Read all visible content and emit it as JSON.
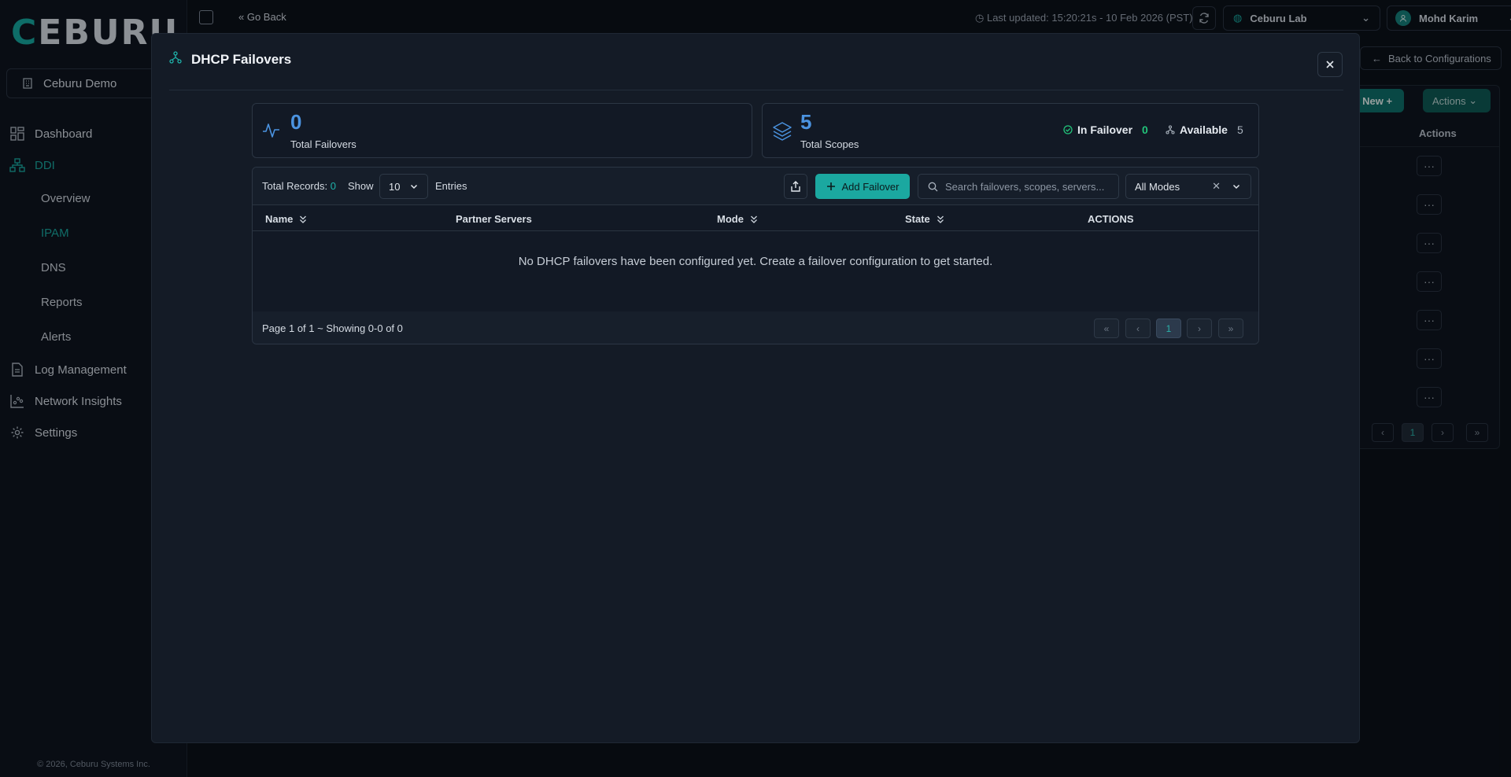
{
  "app": {
    "logo": "CEBURU",
    "org": "Ceburu Demo",
    "nav": [
      {
        "label": "Dashboard",
        "icon": "dashboard-icon"
      },
      {
        "label": "DDI",
        "icon": "network-icon",
        "active": true
      }
    ],
    "ddi_sub": [
      {
        "label": "Overview"
      },
      {
        "label": "IPAM",
        "active": true
      },
      {
        "label": "DNS"
      },
      {
        "label": "Reports"
      },
      {
        "label": "Alerts"
      }
    ],
    "nav_bottom": [
      {
        "label": "Log Management",
        "icon": "file-icon"
      },
      {
        "label": "Network Insights",
        "icon": "insights-icon"
      },
      {
        "label": "Settings",
        "icon": "gear-icon"
      }
    ],
    "copyright": "© 2026, Ceburu Systems Inc."
  },
  "topbar": {
    "go_back": "Go Back",
    "last_updated": "Last updated: 15:20:21s - 10 Feb 2026 (PST)",
    "lab": "Ceburu Lab",
    "user": "Mohd Karim"
  },
  "background": {
    "back_to_config": "Back to Configurations",
    "create_new": "te New",
    "actions": "Actions",
    "actions_header": "Actions",
    "row_menu": "···",
    "page": "1"
  },
  "modal": {
    "title": "DHCP Failovers",
    "stats": {
      "total_failovers": {
        "value": "0",
        "label": "Total Failovers"
      },
      "total_scopes": {
        "value": "5",
        "label": "Total Scopes"
      },
      "in_failover": {
        "label": "In Failover",
        "value": "0"
      },
      "available": {
        "label": "Available",
        "value": "5"
      }
    },
    "toolbar": {
      "total_records_label": "Total Records:",
      "total_records_value": "0",
      "show_label": "Show",
      "show_value": "10",
      "entries_label": "Entries",
      "add_button": "Add Failover",
      "search_placeholder": "Search failovers, scopes, servers...",
      "mode_value": "All Modes"
    },
    "columns": [
      "Name",
      "Partner Servers",
      "Mode",
      "State",
      "ACTIONS"
    ],
    "empty_message": "No DHCP failovers have been configured yet. Create a failover configuration to get started.",
    "pagination": {
      "info": "Page 1 of 1 ~ Showing 0-0 of 0",
      "current_page": "1"
    }
  },
  "colors": {
    "accent": "#1ba8a0",
    "stat_number": "#4b93e0",
    "success": "#22c37a"
  }
}
